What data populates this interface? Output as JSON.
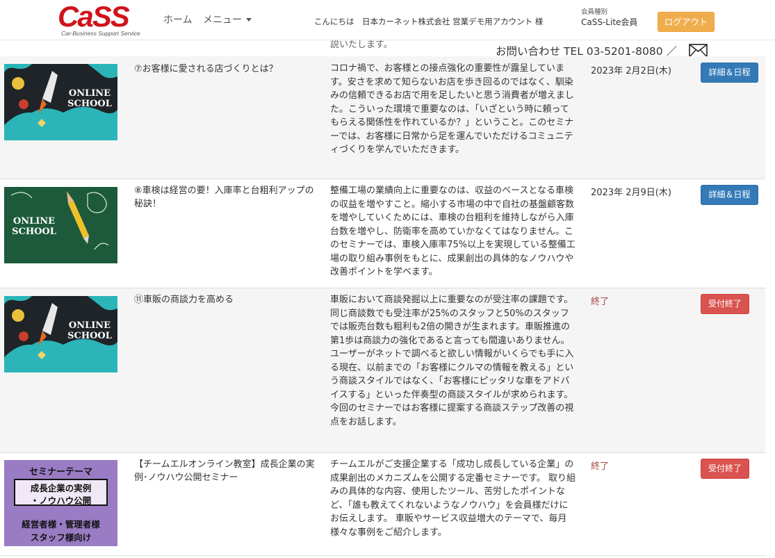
{
  "header": {
    "logo_text": "CaSS",
    "logo_sub": "Car-Business Support Service",
    "nav_home": "ホーム",
    "nav_menu": "メニュー",
    "greeting": "こんにちは　日本カーネット株式会社 営業デモ用アカウント 様",
    "member_label": "会員種別",
    "member_value": "CaSS-Lite会員",
    "logout": "ログアウト"
  },
  "clipped_text": "説いたします。",
  "contact": "お問い合わせ TEL 03-5201-8080 ／",
  "thumb": {
    "online": "ONLINE",
    "school": "SCHOOL",
    "sem_title": "セミナーテーマ",
    "sem_line1": "成長企業の実例",
    "sem_line2": "・ノウハウ公開",
    "sem_line3": "経営者様・管理者様",
    "sem_line4": "スタッフ様向け"
  },
  "rows": [
    {
      "title": "⑦お客様に愛される店づくりとは？",
      "desc": "コロナ禍で、お客様との接点強化の重要性が露呈しています。安さを求めて知らないお店を歩き回るのではなく、馴染みの信頼できるお店で用を足したいと思う消費者が増えました。こういった環境で重要なのは、「いざという時に頼ってもらえる関係性を作れているか？」ということ。このセミナーでは、お客様に日常から足を運んでいただけるコミュニティづくりを学んでいただきます。",
      "date": "2023年 2月2日(木)",
      "button": "詳細＆日程"
    },
    {
      "title": "⑧車検は経営の要！入庫率と台粗利アップの秘訣！",
      "desc": "整備工場の業績向上に重要なのは、収益のベースとなる車検の収益を増やすこと。縮小する市場の中で自社の基盤顧客数を増やしていくためには、車検の台粗利を維持しながら入庫台数を増やし、防衛率を高めていかなくてはなりません。このセミナーでは、車検入庫率75%以上を実現している整備工場の取り組み事例をもとに、成果創出の具体的なノウハウや改善ポイントを学べます。",
      "date": "2023年 2月9日(木)",
      "button": "詳細＆日程"
    },
    {
      "title": "⑪車販の商談力を高める",
      "desc": "車販において商談発掘以上に重要なのが受注率の課題です。同じ商談数でも受注率が25%のスタッフと50%のスタッフでは販売台数も粗利も2倍の開きが生まれます。車販推進の第1歩は商談力の強化であると言っても間違いありません。ユーザーがネットで調べると欲しい情報がいくらでも手に入る現在、以前までの「お客様にクルマの情報を教える」という商談スタイルではなく、「お客様にピッタリな車をアドバイスする」といった伴奏型の商談スタイルが求められます。今回のセミナーではお客様に提案する商談ステップ改善の視点をお話します。",
      "status": "終了",
      "button": "受付終了"
    },
    {
      "title": "【チームエルオンライン教室】成長企業の実例･ノウハウ公開セミナー",
      "desc": "チームエルがご支援企業する「成功し成長している企業」の成果創出のメカニズムを公開する定番セミナーです。 取り組みの具体的な内容、使用したツール、苦労したポイントなど、「誰も教えてくれないようなノウハウ」を会員様だけにお伝えします。 車販やサービス収益増大のテーマで、毎月様々な事例をご紹介します。",
      "status": "終了",
      "button": "受付終了"
    }
  ]
}
